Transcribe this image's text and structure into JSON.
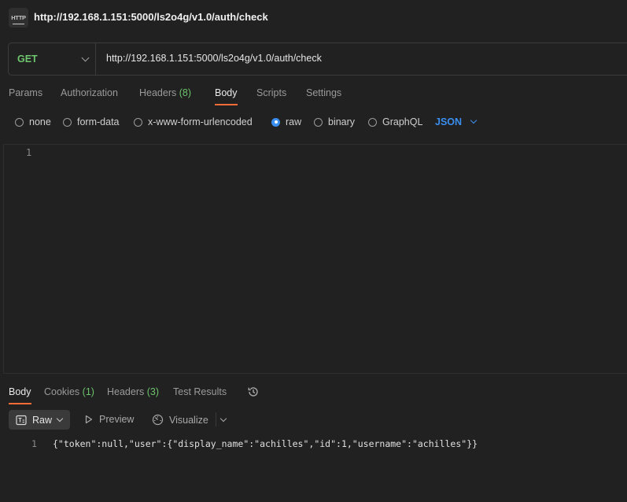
{
  "title": {
    "badge": "HTTP",
    "text": "http://192.168.1.151:5000/ls2o4g/v1.0/auth/check"
  },
  "request": {
    "method": "GET",
    "url": "http://192.168.1.151:5000/ls2o4g/v1.0/auth/check"
  },
  "tabs": {
    "params": "Params",
    "authorization": "Authorization",
    "headers": "Headers",
    "headers_count": "(8)",
    "body": "Body",
    "scripts": "Scripts",
    "settings": "Settings",
    "active": "Body"
  },
  "body_types": {
    "none": "none",
    "form_data": "form-data",
    "urlencoded": "x-www-form-urlencoded",
    "raw": "raw",
    "binary": "binary",
    "graphql": "GraphQL",
    "selected": "raw",
    "language": "JSON"
  },
  "editor": {
    "line_number": "1",
    "content": ""
  },
  "response": {
    "tabs": {
      "body": "Body",
      "cookies": "Cookies",
      "cookies_count": "(1)",
      "headers": "Headers",
      "headers_count": "(3)",
      "test_results": "Test Results"
    },
    "toolbar": {
      "raw": "Raw",
      "preview": "Preview",
      "visualize": "Visualize"
    },
    "line_number": "1",
    "body": "{\"token\":null,\"user\":{\"display_name\":\"achilles\",\"id\":1,\"username\":\"achilles\"}}"
  },
  "colors": {
    "background": "#212121",
    "method_get": "#6ec66e",
    "accent_tab": "#ff6c37",
    "accent_blue": "#3a8ef0",
    "count_green": "#6cc46c"
  }
}
